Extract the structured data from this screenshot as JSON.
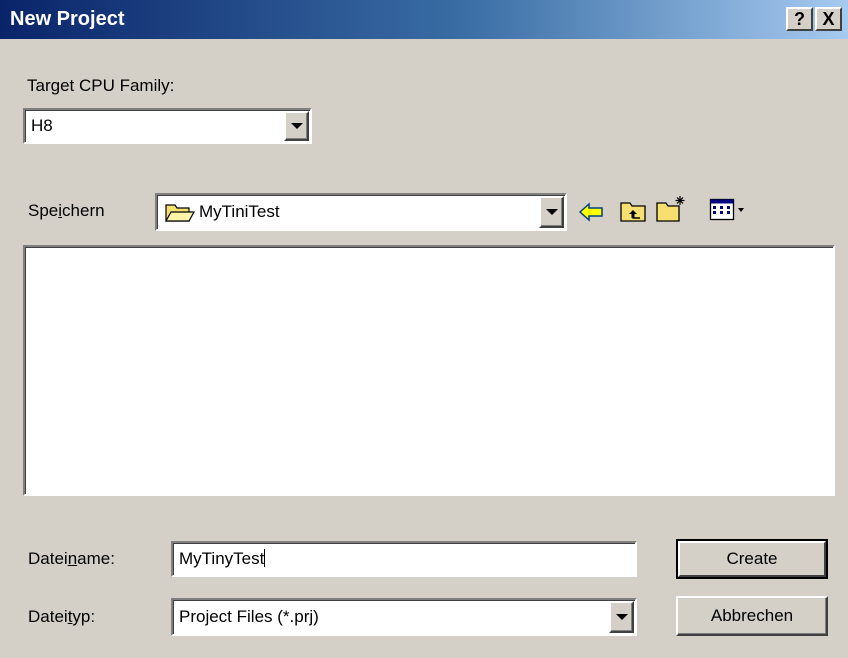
{
  "window": {
    "title": "New Project",
    "help_button": "?",
    "close_button": "X"
  },
  "target_cpu": {
    "label": "Target CPU Family:",
    "value": "H8"
  },
  "save_in": {
    "label_pre": "Spe",
    "label_accel": "i",
    "label_post": "chern",
    "folder": "MyTiniTest",
    "folder_icon": "folder-open-icon",
    "toolbar": [
      "back-arrow-icon",
      "up-folder-icon",
      "new-folder-icon",
      "view-menu-icon"
    ]
  },
  "file_list": [],
  "filename": {
    "label_pre": "Datei",
    "label_accel": "n",
    "label_post": "ame:",
    "value": "MyTinyTest"
  },
  "filetype": {
    "label_pre": "Datei",
    "label_accel": "t",
    "label_post": "yp:",
    "value": "Project Files (*.prj)"
  },
  "buttons": {
    "create": "Create",
    "cancel": "Abbrechen"
  },
  "colors": {
    "title_start": "#0a246a",
    "title_end": "#a6caf0",
    "face": "#d4d0c8",
    "folder_yellow": "#f8e070",
    "arrow_yellow": "#ffff00"
  }
}
